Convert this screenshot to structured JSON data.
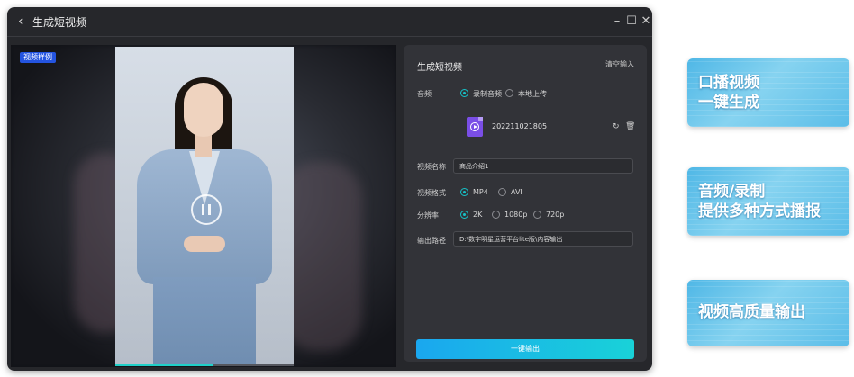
{
  "window": {
    "title": "生成短视频",
    "back_icon": "chevron-left-icon",
    "controls": [
      "minimize-icon",
      "maximize-icon",
      "close-icon"
    ]
  },
  "preview": {
    "badge": "视频样例",
    "state_icon": "pause-icon",
    "progress": 0.55
  },
  "panel": {
    "title": "生成短视频",
    "clear": "清空输入",
    "audio": {
      "label": "音频",
      "options": [
        "录制音频",
        "本地上传"
      ],
      "selected": "录制音频",
      "file_name": "202211021805",
      "file_icon": "audio-file-icon",
      "actions": [
        "refresh-icon",
        "trash-icon"
      ]
    },
    "video_name": {
      "label": "视频名称",
      "value": "商品介绍1"
    },
    "format": {
      "label": "视频格式",
      "options": [
        "MP4",
        "AVI"
      ],
      "selected": "MP4"
    },
    "resolution": {
      "label": "分辨率",
      "options": [
        "2K",
        "1080p",
        "720p"
      ],
      "selected": "2K"
    },
    "output_path": {
      "label": "输出路径",
      "value": "D:\\数字明星运营平台lite版\\内容输出"
    },
    "export_label": "一键输出"
  },
  "promos": [
    {
      "lines": [
        "口播视频",
        "一键生成"
      ]
    },
    {
      "lines": [
        "音频/录制",
        "提供多种方式播报"
      ]
    },
    {
      "lines": [
        "视频高质量输出"
      ]
    }
  ],
  "colors": {
    "accent": "#16c2c7",
    "button_start": "#1aa7ef",
    "button_end": "#19d2d8",
    "badge": "#2454e0"
  }
}
